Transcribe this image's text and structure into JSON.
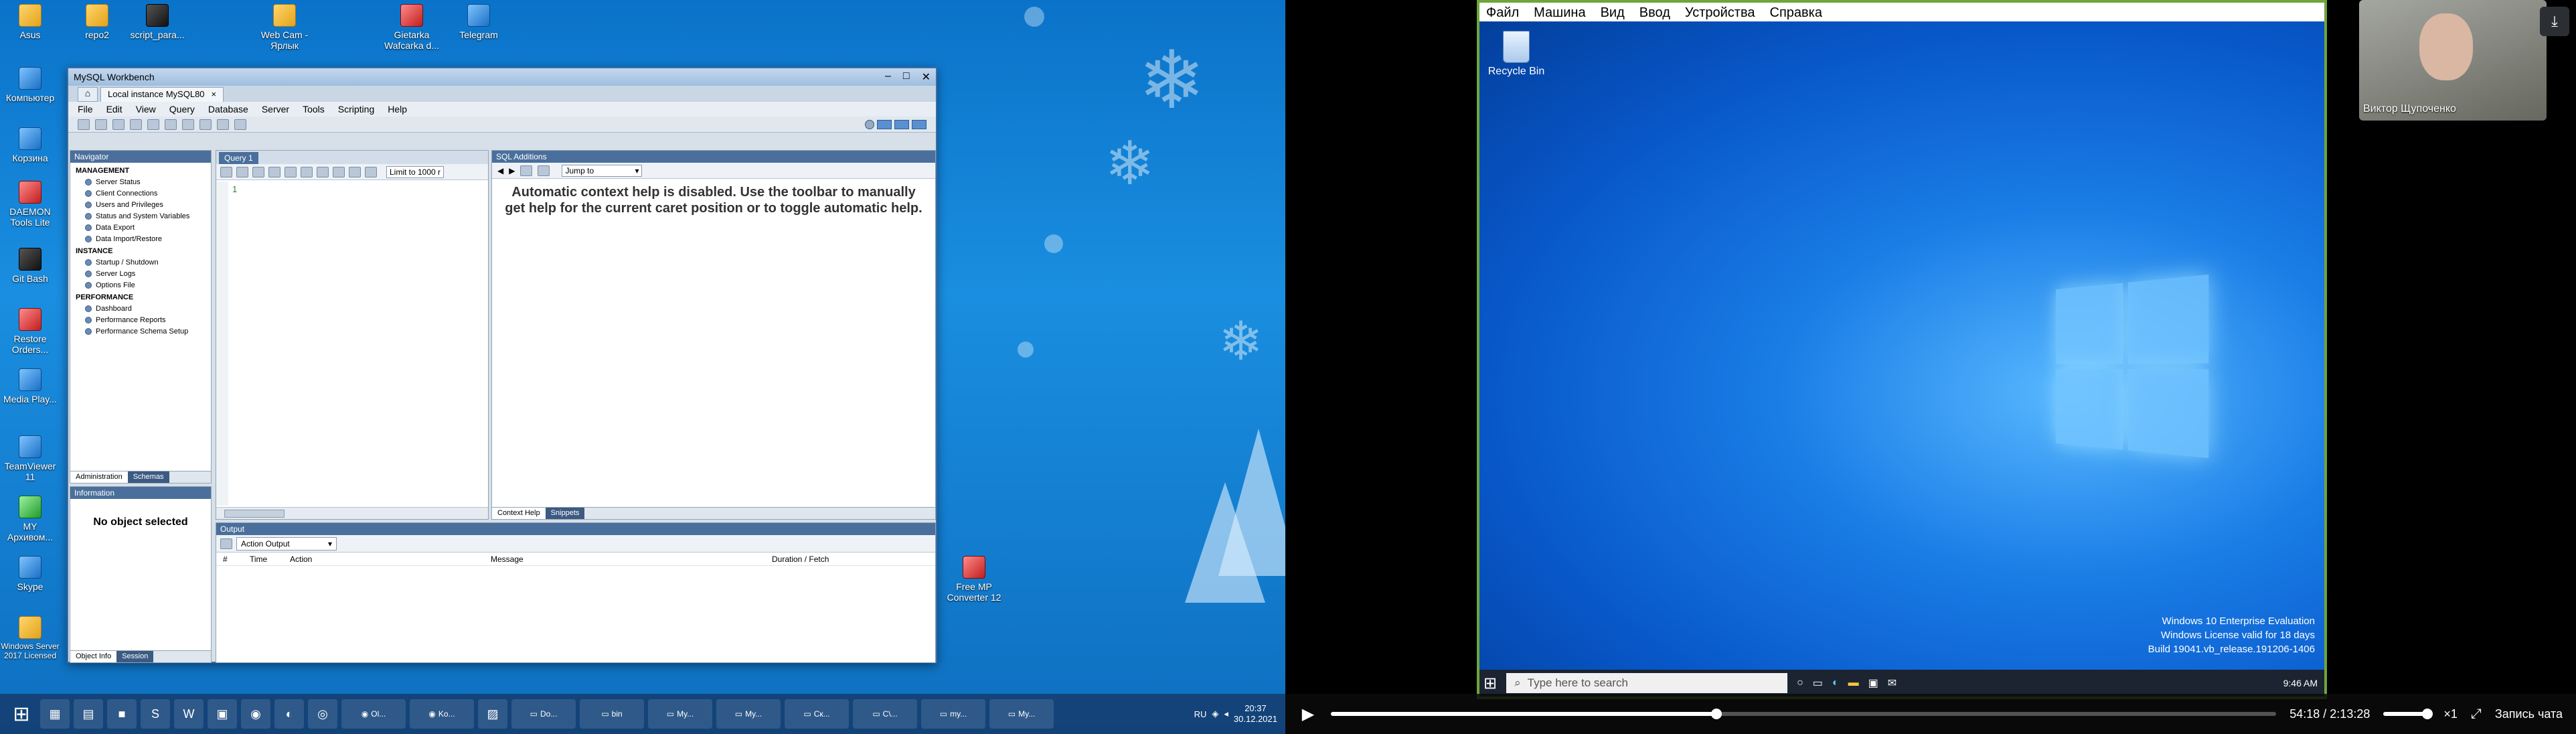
{
  "left_desktop": {
    "icons": [
      {
        "label": "Asus"
      },
      {
        "label": "repo2"
      },
      {
        "label": "script_para..."
      },
      {
        "label": "Web Cam - Ярлык"
      },
      {
        "label": "Gietarka Wafcarka d..."
      },
      {
        "label": "Telegram"
      },
      {
        "label": "Компьютер"
      },
      {
        "label": "Корзина"
      },
      {
        "label": "DAEMON Tools Lite"
      },
      {
        "label": "Git Bash"
      },
      {
        "label": "Restore Orders..."
      },
      {
        "label": "Media Play..."
      },
      {
        "label": "TeamViewer 11"
      },
      {
        "label": "MY Архивом..."
      },
      {
        "label": "Skype"
      },
      {
        "label": "Windows Server 2017 Licensed"
      },
      {
        "label": "Free MP Converter 12"
      }
    ]
  },
  "workbench": {
    "title": "MySQL Workbench",
    "tab": "Local instance MySQL80",
    "menu": [
      "File",
      "Edit",
      "View",
      "Query",
      "Database",
      "Server",
      "Tools",
      "Scripting",
      "Help"
    ],
    "navigator": {
      "header": "Navigator",
      "management_title": "MANAGEMENT",
      "management": [
        "Server Status",
        "Client Connections",
        "Users and Privileges",
        "Status and System Variables",
        "Data Export",
        "Data Import/Restore"
      ],
      "instance_title": "INSTANCE",
      "instance": [
        "Startup / Shutdown",
        "Server Logs",
        "Options File"
      ],
      "performance_title": "PERFORMANCE",
      "performance": [
        "Dashboard",
        "Performance Reports",
        "Performance Schema Setup"
      ],
      "tabs": [
        "Administration",
        "Schemas"
      ]
    },
    "info": {
      "header": "Information",
      "empty": "No object selected",
      "tabs": [
        "Object Info",
        "Session"
      ]
    },
    "query": {
      "tab": "Query 1",
      "limit": "Limit to 1000 r",
      "line_number": "1"
    },
    "sql_additions": {
      "header": "SQL Additions",
      "jump_to": "Jump to",
      "help_text": "Automatic context help is disabled. Use the toolbar to manually get help for the current caret position or to toggle automatic help.",
      "tabs": [
        "Context Help",
        "Snippets"
      ]
    },
    "output": {
      "header": "Output",
      "selector": "Action Output",
      "columns": [
        "#",
        "Time",
        "Action",
        "Message",
        "Duration / Fetch"
      ]
    }
  },
  "left_taskbar": {
    "apps": [
      "Ol...",
      "Ko...",
      "Do...",
      "bin",
      "My...",
      "My...",
      "Ск...",
      "C\\...",
      "my...",
      "My..."
    ],
    "lang": "RU",
    "time": "20:37",
    "date": "30.12.2021"
  },
  "vm": {
    "menu": [
      "Файл",
      "Машина",
      "Вид",
      "Ввод",
      "Устройства",
      "Справка"
    ],
    "recycle_bin": "Recycle Bin",
    "eval_lines": [
      "Windows 10 Enterprise Evaluation",
      "Windows License valid for 18 days",
      "Build 19041.vb_release.191206-1406"
    ],
    "search_placeholder": "Type here to search",
    "tray_time": "9:46 AM"
  },
  "webcam": {
    "name": "Виктор Щупоченко"
  },
  "player": {
    "time": "54:18 / 2:13:28",
    "progress": 0.408,
    "speed": "×1",
    "chat_label": "Запись чата"
  }
}
